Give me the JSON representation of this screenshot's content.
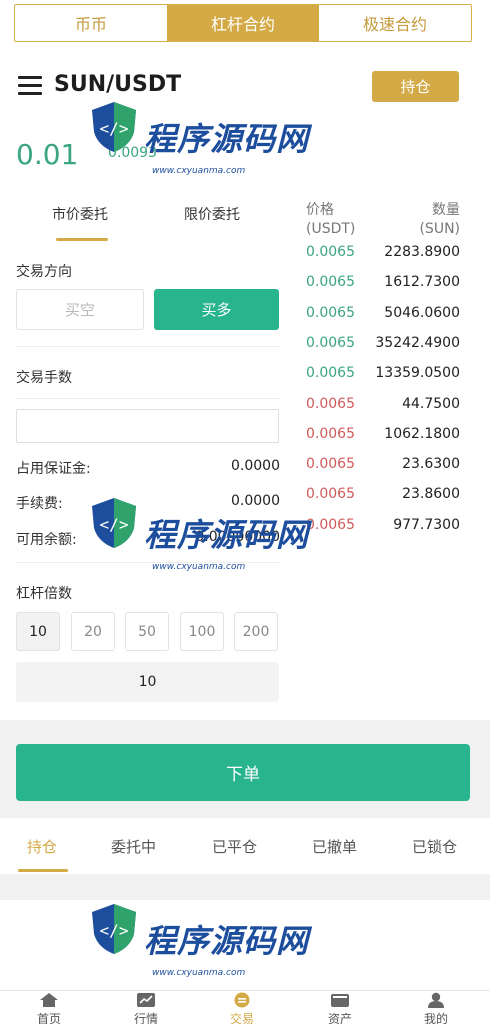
{
  "top_tabs": [
    "币币",
    "杠杆合约",
    "极速合约"
  ],
  "header": {
    "pair": "SUN/USDT",
    "hold_button": "持仓"
  },
  "price": {
    "last": "0.01",
    "sub": "0.0093"
  },
  "order_type_tabs": [
    "市价委托",
    "限价委托"
  ],
  "direction": {
    "label": "交易方向",
    "sell": "买空",
    "buy": "买多"
  },
  "quantity": {
    "label": "交易手数",
    "value": ""
  },
  "info": [
    {
      "label": "占用保证金:",
      "value": "0.0000"
    },
    {
      "label": "手续费:",
      "value": "0.0000"
    },
    {
      "label": "可用余额:",
      "value": "0.00000000"
    }
  ],
  "leverage": {
    "label": "杠杆倍数",
    "options": [
      "10",
      "20",
      "50",
      "100",
      "200"
    ],
    "selected": "10"
  },
  "order_book": {
    "price_header": "价格",
    "price_unit": "(USDT)",
    "qty_header": "数量",
    "qty_unit": "(SUN)",
    "rows": [
      {
        "price": "0.0065",
        "qty": "2283.8900",
        "side": "up"
      },
      {
        "price": "0.0065",
        "qty": "1612.7300",
        "side": "up"
      },
      {
        "price": "0.0065",
        "qty": "5046.0600",
        "side": "up"
      },
      {
        "price": "0.0065",
        "qty": "35242.4900",
        "side": "up"
      },
      {
        "price": "0.0065",
        "qty": "13359.0500",
        "side": "up"
      },
      {
        "price": "0.0065",
        "qty": "44.7500",
        "side": "down"
      },
      {
        "price": "0.0065",
        "qty": "1062.1800",
        "side": "down"
      },
      {
        "price": "0.0065",
        "qty": "23.6300",
        "side": "down"
      },
      {
        "price": "0.0065",
        "qty": "23.8600",
        "side": "down"
      },
      {
        "price": "0.0065",
        "qty": "977.7300",
        "side": "down"
      }
    ]
  },
  "place_order": "下单",
  "bottom_tabs": [
    "持仓",
    "委托中",
    "已平仓",
    "已撤单",
    "已锁仓"
  ],
  "nav": [
    "首页",
    "行情",
    "交易",
    "资产",
    "我的"
  ],
  "watermark": {
    "title": "程序源码网",
    "url": "www.cxyuanma.com"
  },
  "colors": {
    "gold": "#d4aa47",
    "green": "#28b48c",
    "up": "#3aa57e",
    "down": "#d05a5a"
  }
}
